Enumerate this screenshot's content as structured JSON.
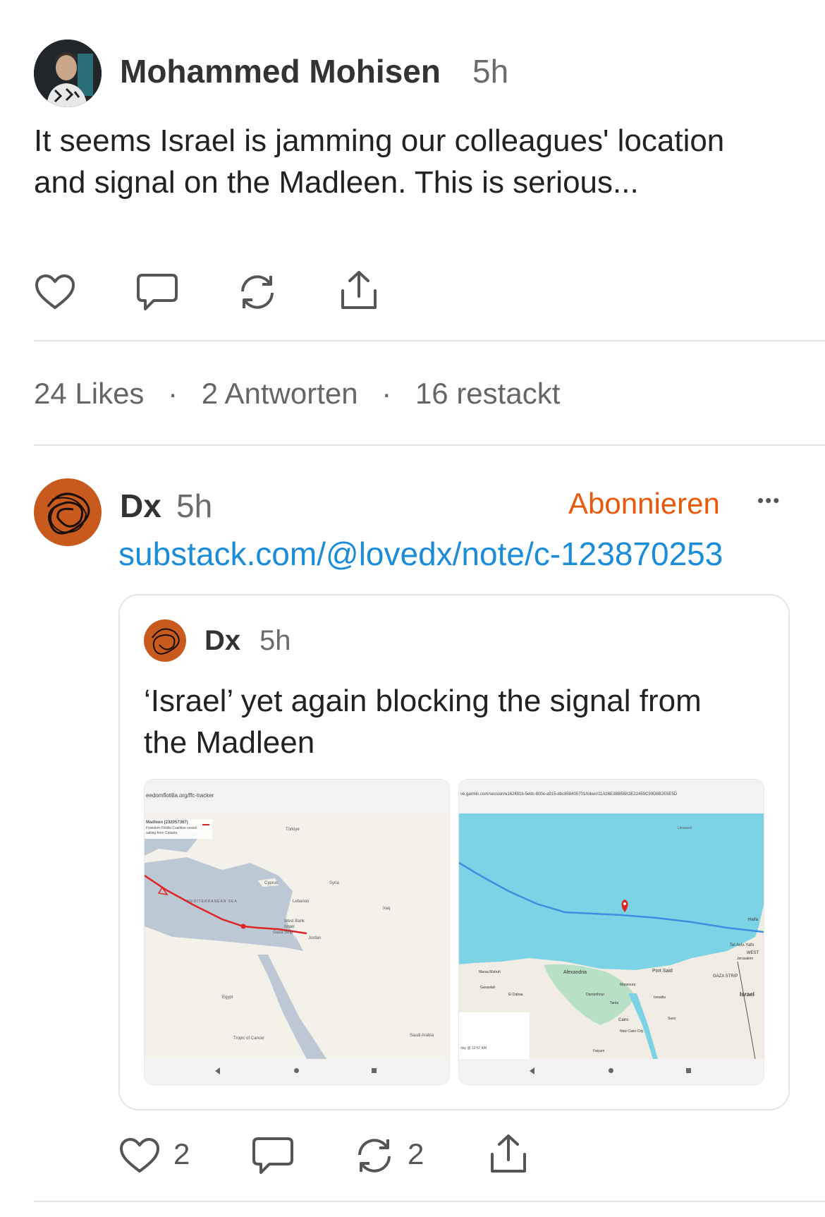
{
  "post": {
    "author": "Mohammed Mohisen",
    "time": "5h",
    "text": "It seems Israel is jamming our colleagues' location and signal on the Madleen. This is serious...",
    "icons": [
      "heart-icon",
      "comment-icon",
      "restack-icon",
      "share-icon"
    ]
  },
  "stats": {
    "likes": "24 Likes",
    "replies": "2 Antworten",
    "restacks": "16 restackt",
    "separator": "·"
  },
  "reply": {
    "author": "Dx",
    "time": "5h",
    "subscribe_label": "Abonnieren",
    "more_label": "•••",
    "link": "substack.com/@lovedx/note/c-123870253",
    "quoted": {
      "author": "Dx",
      "time": "5h",
      "text": "‘Israel’ yet again blocking the signal from the Madleen",
      "images": [
        {
          "url": "eedomflotilla.org/ffc-tracker",
          "legend_title": "Madleen (232057367)",
          "legend_line1": "Freedom Flotilla Coalition vessel",
          "legend_line2": "sailing from Catania",
          "labels": {
            "turkiye": "Türkiye",
            "cyprus": "Cyprus",
            "syria": "Syria",
            "lebanon": "Lebanon",
            "iraq": "Iraq",
            "sea": "MEDITERRANEAN SEA",
            "westbank": "West Bank",
            "israel": "Israel",
            "gaza": "Gaza Strip",
            "jordan": "Jordan",
            "egypt": "Egypt",
            "tropic": "Tropic of Cancer",
            "saudi": "Saudi Arabia"
          }
        },
        {
          "url": "ve.garmin.com/session/e162481b-5edc-800e-a915-dbc858405701/token/11A26E3BB58A3E22459C99D6B2E5E5D",
          "labels": {
            "limassol": "Limassol",
            "haifa": "Haifa",
            "telaviv": "Tel Aviv-Yafo",
            "west": "WEST",
            "jerusalem": "Jerusalem",
            "gaza": "GAZA STRIP",
            "israel": "Israel",
            "alexandria": "Alexandria",
            "portsaid": "Port Said",
            "mansoura": "Mansoura",
            "damanhour": "Damanhour",
            "tanta": "Tanta",
            "ismailia": "Ismailia",
            "cairo": "Cairo",
            "suez": "Suez",
            "newcairo": "New Cairo City",
            "faiyum": "Faiyum",
            "marsa": "Marsa Matruh",
            "garawlah": "Garawlah",
            "eldabaa": "El Dabaa",
            "timestamp": "day @ 10:57 AM"
          }
        }
      ]
    },
    "actions": {
      "likes": "2",
      "restacks": "2"
    }
  },
  "colors": {
    "accent": "#e8590c",
    "link": "#1a8cd8",
    "text": "#222222",
    "muted": "#6b6b6b",
    "sea_garmin": "#7dd3e6",
    "track_red": "#e02424"
  }
}
